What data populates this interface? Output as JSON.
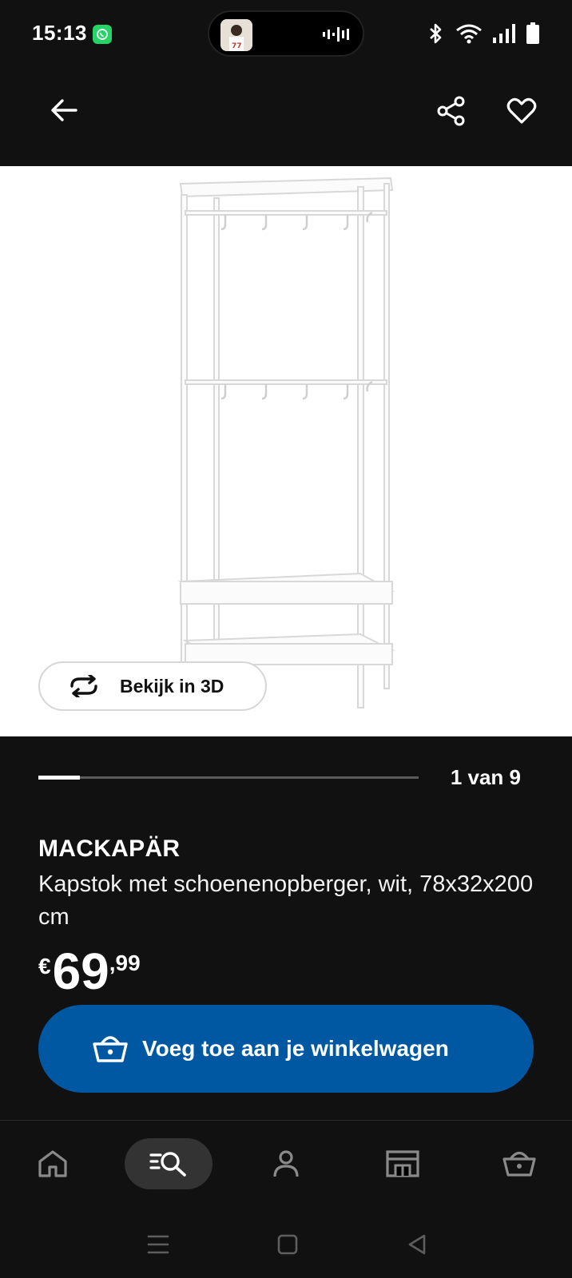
{
  "status_bar": {
    "time": "15:13"
  },
  "header": {
    "back": "back",
    "share": "share",
    "favorite": "favorite"
  },
  "product_image": {
    "view_3d_label": "Bekijk in 3D"
  },
  "pager": {
    "text": "1 van 9",
    "progress": 0.11
  },
  "product": {
    "name": "MACKAPÄR",
    "description": "Kapstok met schoenenopberger, wit, 78x32x200 cm",
    "price_currency": "€",
    "price_integer": "69",
    "price_decimal": ",99"
  },
  "cart_button": {
    "label": "Voeg toe aan je winkelwagen"
  },
  "bottom_nav": {
    "items": [
      {
        "icon": "home-icon"
      },
      {
        "icon": "search-icon",
        "active": true
      },
      {
        "icon": "profile-icon"
      },
      {
        "icon": "store-icon"
      },
      {
        "icon": "basket-icon"
      }
    ]
  },
  "colors": {
    "background": "#111111",
    "accent": "#0058a3",
    "image_bg": "#ffffff"
  }
}
